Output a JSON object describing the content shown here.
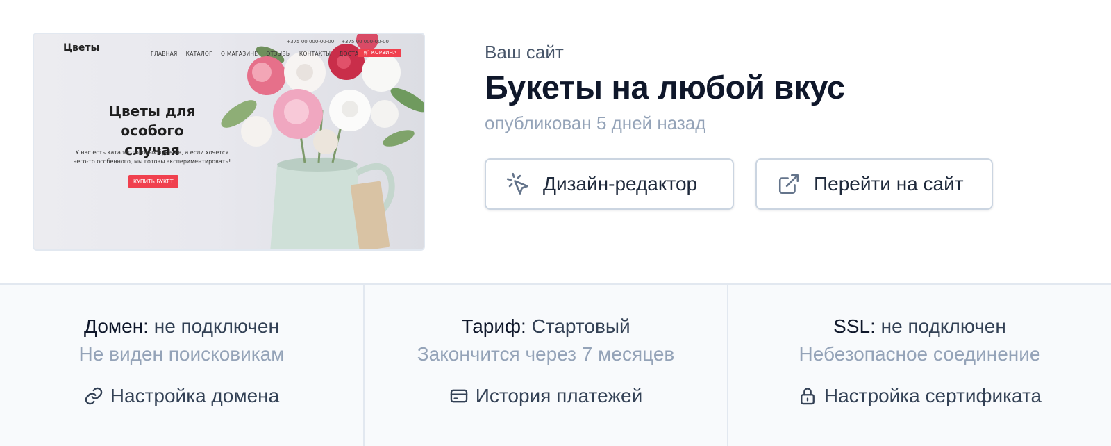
{
  "preview": {
    "logo": "Цветы",
    "phones": [
      "+375 00 000-00-00",
      "+375 00 000-00-00"
    ],
    "nav": [
      "ГЛАВНАЯ",
      "КАТАЛОГ",
      "О МАГАЗИНЕ",
      "ОТЗЫВЫ",
      "КОНТАКТЫ",
      "ДОСТАВКА"
    ],
    "cart_label": "КОРЗИНА",
    "hero_title_line1": "Цветы для особого",
    "hero_title_line2": "случая",
    "hero_text_line1": "У нас есть каталог готовых букетов, а если хочется",
    "hero_text_line2": "чего-то особенного, мы готовы экспериментировать!",
    "buy_button": "КУПИТЬ БУКЕТ",
    "accent_color": "#f0404e"
  },
  "site": {
    "label": "Ваш сайт",
    "title": "Букеты на любой вкус",
    "published": "опубликован 5 дней назад"
  },
  "actions": {
    "editor": {
      "label": "Дизайн-редактор",
      "icon": "cursor-click-icon"
    },
    "visit": {
      "label": "Перейти на сайт",
      "icon": "external-link-icon"
    }
  },
  "status": {
    "domain": {
      "key": "Домен:",
      "value": "не подключен",
      "note": "Не виден поисковикам",
      "action": "Настройка домена",
      "icon": "link-icon"
    },
    "tariff": {
      "key": "Тариф:",
      "value": "Стартовый",
      "note": "Закончится через 7 месяцев",
      "action": "История платежей",
      "icon": "credit-card-icon"
    },
    "ssl": {
      "key": "SSL:",
      "value": "не подключен",
      "note": "Небезопасное соединение",
      "action": "Настройка сертификата",
      "icon": "lock-icon"
    }
  },
  "colors": {
    "text_primary": "#0f172a",
    "text_secondary": "#334155",
    "text_muted": "#94a3b8",
    "border": "#e2e8f0",
    "footer_bg": "#f8fafc"
  }
}
